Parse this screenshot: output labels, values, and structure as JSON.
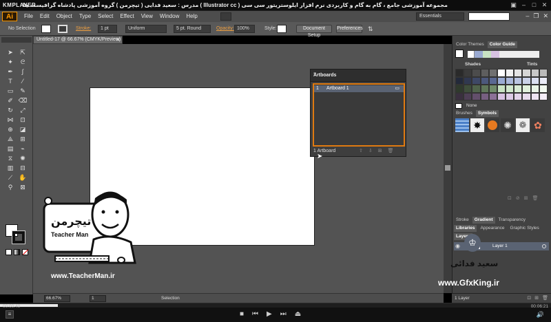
{
  "player": {
    "brand": "KMPLAYER",
    "title": "مجموعه آموزشی جامع ، گام به گام و کاربردی نرم افزار ایلوستریتور سی سی ( Illustrator cc ) مدرس : سعید فدایی ( تیچرمن ) گروه آموزشی پادشاه گرافیست ها",
    "time_elapsed": "00:00:40",
    "time_total": "00:06:21",
    "progress_fraction": 0.105
  },
  "menubar": {
    "logo": "Ai",
    "menus": [
      "File",
      "Edit",
      "Object",
      "Type",
      "Select",
      "Effect",
      "View",
      "Window",
      "Help"
    ],
    "workspace": "Essentials"
  },
  "control_bar": {
    "selection": "No Selection",
    "stroke_label": "Stroke:",
    "stroke_value": "1 pt",
    "profile": "Uniform",
    "brush": "5 pt. Round",
    "opacity_label": "Opacity:",
    "opacity_value": "100%",
    "style_label": "Style:",
    "doc_setup": "Document Setup",
    "preferences": "Preferences"
  },
  "document": {
    "tab": "Untitled-17 @ 66.67% (CMYK/Preview)",
    "zoom": "66.67%",
    "page": "1",
    "status": "Selection"
  },
  "artboards_panel": {
    "title": "Artboards",
    "rows": [
      {
        "index": "1",
        "name": "Artboard 1"
      }
    ],
    "footer": "1 Artboard"
  },
  "right_panels": {
    "color_tabs": [
      "Color Themes",
      "Color Guide"
    ],
    "shades": "Shades",
    "tints": "Tints",
    "none": "None",
    "brush_tabs": [
      "Brushes",
      "Symbols"
    ],
    "stroke_tabs": [
      "Stroke",
      "Gradient",
      "Transparency"
    ],
    "lib_tabs": [
      "Libraries",
      "Appearance",
      "Graphic Styles"
    ],
    "layers_title": "Layers",
    "layer_name": "Layer 1",
    "layer_count": "1 Layer"
  },
  "colors": {
    "ai_orange": "#ff9a00",
    "selection_orange": "#e07a10",
    "layer_blue": "#5a6373"
  },
  "watermarks": {
    "teacherman_url": "www.TeacherMan.ir",
    "teacherman_logo": "تیچرمن",
    "teacherman_en": "Teacher Man",
    "gfxking_name": "سعید فدائی",
    "gfxking_url": "www.GfxKing.ir"
  }
}
